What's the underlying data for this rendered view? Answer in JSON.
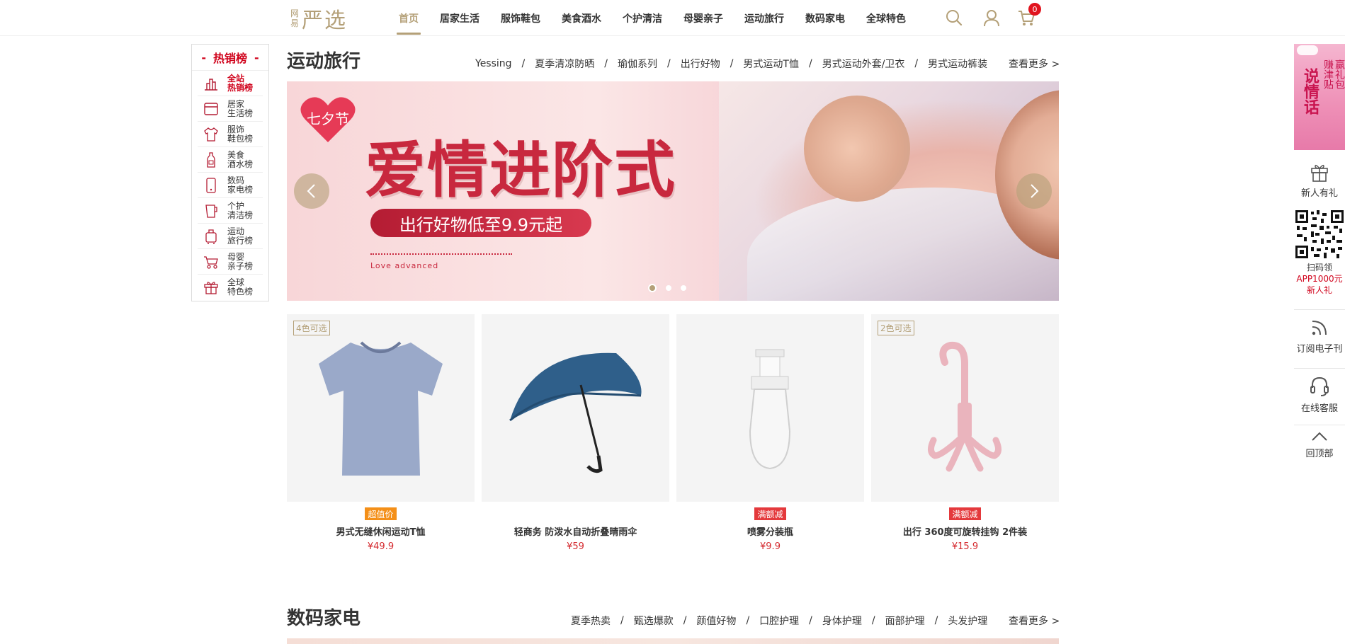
{
  "logo": {
    "small_top": "网",
    "small_bottom": "易",
    "main": "严选"
  },
  "nav": {
    "items": [
      "首页",
      "居家生活",
      "服饰鞋包",
      "美食酒水",
      "个护清洁",
      "母婴亲子",
      "运动旅行",
      "数码家电",
      "全球特色"
    ],
    "active": "首页",
    "cart_count": "0",
    "icons": [
      "search-icon",
      "user-icon",
      "cart-icon"
    ]
  },
  "bestseller": {
    "title": "热销榜",
    "items": [
      {
        "line1": "全站",
        "line2": "热销榜",
        "icon": "bar-chart-icon"
      },
      {
        "line1": "居家",
        "line2": "生活榜",
        "icon": "window-icon"
      },
      {
        "line1": "服饰",
        "line2": "鞋包榜",
        "icon": "shirt-icon"
      },
      {
        "line1": "美食",
        "line2": "酒水榜",
        "icon": "bottle-icon"
      },
      {
        "line1": "数码",
        "line2": "家电榜",
        "icon": "phone-icon"
      },
      {
        "line1": "个护",
        "line2": "清洁榜",
        "icon": "cup-icon"
      },
      {
        "line1": "运动",
        "line2": "旅行榜",
        "icon": "luggage-icon"
      },
      {
        "line1": "母婴",
        "line2": "亲子榜",
        "icon": "stroller-icon"
      },
      {
        "line1": "全球",
        "line2": "特色榜",
        "icon": "gift-icon"
      }
    ]
  },
  "section1": {
    "title": "运动旅行",
    "subnav": [
      "Yessing",
      "夏季清凉防晒",
      "瑜伽系列",
      "出行好物",
      "男式运动T恤",
      "男式运动外套/卫衣",
      "男式运动裤装"
    ],
    "more": "查看更多 >",
    "banner": {
      "heart_text": "七夕节",
      "headline": "爱情进阶式",
      "pill": "出行好物低至9.9元起",
      "tagline": "Love advanced",
      "slides": 3,
      "active_slide": 0
    },
    "products": [
      {
        "tag": "4色可选",
        "badge": "超值价",
        "badge_color": "#f48f18",
        "name": "男式无缝休闲运动T恤",
        "price": "¥49.9",
        "icon": "tshirt-icon"
      },
      {
        "tag": "",
        "badge": "",
        "badge_color": "",
        "name": "轻商务 防泼水自动折叠晴雨伞",
        "price": "¥59",
        "icon": "umbrella-icon"
      },
      {
        "tag": "",
        "badge": "满额减",
        "badge_color": "#e4393c",
        "name": "喷雾分装瓶",
        "price": "¥9.9",
        "icon": "spray-bottle-icon"
      },
      {
        "tag": "2色可选",
        "badge": "满额减",
        "badge_color": "#e4393c",
        "name": "出行 360度可旋转挂钩 2件装",
        "price": "¥15.9",
        "icon": "hook-icon"
      }
    ]
  },
  "section2": {
    "title": "数码家电",
    "subnav": [
      "夏季热卖",
      "甄选爆款",
      "颜值好物",
      "口腔护理",
      "身体护理",
      "面部护理",
      "头发护理"
    ],
    "more": "查看更多 >"
  },
  "right_sidebar": {
    "banner_main": "说情话",
    "banner_col1": "赚津贴",
    "banner_col2": "赢礼包",
    "gift_label": "新人有礼",
    "qr_line1": "扫码领",
    "qr_line2": "APP1000元",
    "qr_line3": "新人礼",
    "subscribe_label": "订阅电子刊",
    "service_label": "在线客服",
    "top_label": "回顶部"
  },
  "colors": {
    "accent": "#b4a078",
    "red": "#d0021b",
    "price": "#d4282d"
  }
}
